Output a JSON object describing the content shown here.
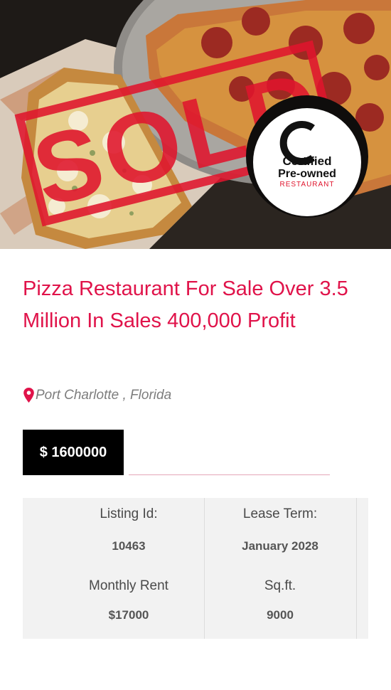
{
  "listing": {
    "image": {
      "stamp_text": "SOLD",
      "badge": {
        "line1": "Certified",
        "line2": "Pre-owned",
        "line3": "RESTAURANT"
      }
    },
    "title": "Pizza Restaurant For Sale Over 3.5 Million In Sales 400,000 Profit",
    "location": "Port Charlotte , Florida",
    "price": "$ 1600000",
    "details": {
      "listing_id_label": "Listing Id:",
      "listing_id_value": "10463",
      "lease_term_label": "Lease Term:",
      "lease_term_value": "January 2028",
      "monthly_rent_label": "Monthly Rent",
      "monthly_rent_value": "$17000",
      "sqft_label": "Sq.ft.",
      "sqft_value": "9000"
    }
  },
  "colors": {
    "accent": "#e0134a",
    "price_bg": "#000000",
    "details_bg": "#f2f2f2",
    "location_text": "#7d7d7d"
  },
  "icons": {
    "location": "map-pin-icon"
  }
}
